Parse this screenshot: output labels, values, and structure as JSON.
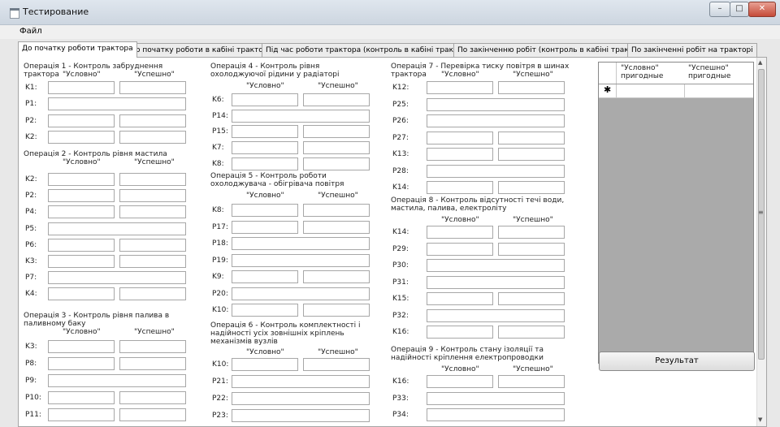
{
  "window": {
    "title": "Тестирование",
    "buttons": {
      "minimize": "–",
      "maximize": "□",
      "close": "✕"
    }
  },
  "menu": {
    "file": "Файл"
  },
  "tabs": [
    "До початку роботи трактора",
    "До початку роботи в кабіні трактора",
    "Під час роботи трактора (контроль в кабіні трактора)",
    "По закінченню робіт (контроль в кабіні трактора)",
    "По закінченні робіт на тракторі"
  ],
  "columns": {
    "c1": "\"Условно\"",
    "c2": "\"Успешно\""
  },
  "operations": [
    {
      "title": "Операція 1 - Контроль забруднення трактора",
      "rows": [
        {
          "label": "K1:",
          "split": true
        },
        {
          "label": "P1:",
          "split": false
        },
        {
          "label": "P2:",
          "split": true
        },
        {
          "label": "K2:",
          "split": true
        }
      ]
    },
    {
      "title": "Операція 2 - Контроль рівня мастила",
      "rows": [
        {
          "label": "K2:",
          "split": true
        },
        {
          "label": "P2:",
          "split": true
        },
        {
          "label": "P4:",
          "split": true
        },
        {
          "label": "P5:",
          "split": false
        },
        {
          "label": "P6:",
          "split": true
        },
        {
          "label": "K3:",
          "split": true
        },
        {
          "label": "P7:",
          "split": false
        },
        {
          "label": "K4:",
          "split": true
        }
      ]
    },
    {
      "title": "Операція 3 - Контроль рівня палива в паливному баку",
      "rows": [
        {
          "label": "K3:",
          "split": true
        },
        {
          "label": "P8:",
          "split": true
        },
        {
          "label": "P9:",
          "split": false
        },
        {
          "label": "P10:",
          "split": true
        },
        {
          "label": "P11:",
          "split": true
        }
      ]
    },
    {
      "title": "Операція 4 -   Контроль рівня охолоджуючої рідини у радіаторі",
      "rows": [
        {
          "label": "K6:",
          "split": true
        },
        {
          "label": "P14:",
          "split": false
        },
        {
          "label": "P15:",
          "split": true
        },
        {
          "label": "K7:",
          "split": true
        },
        {
          "label": "K8:",
          "split": true
        }
      ]
    },
    {
      "title": "Операція 5 - Контроль роботи охолоджувача - обігрівача повітря",
      "rows": [
        {
          "label": "K8:",
          "split": true
        },
        {
          "label": "P17:",
          "split": true
        },
        {
          "label": "P18:",
          "split": false
        },
        {
          "label": "P19:",
          "split": false
        },
        {
          "label": "K9:",
          "split": true
        },
        {
          "label": "P20:",
          "split": false
        },
        {
          "label": "K10:",
          "split": true
        }
      ]
    },
    {
      "title": "Операція 6 - Контроль комплектності і надійності усіх зовнішніх кріплень механізмів вузлів",
      "rows": [
        {
          "label": "K10:",
          "split": true
        },
        {
          "label": "P21:",
          "split": false
        },
        {
          "label": "P22:",
          "split": false
        },
        {
          "label": "P23:",
          "split": false
        }
      ]
    },
    {
      "title": "Операція 7 - Перевірка тиску повітря в шинах трактора",
      "rows": [
        {
          "label": "K12:",
          "split": true
        },
        {
          "label": "P25:",
          "split": false
        },
        {
          "label": "P26:",
          "split": false
        },
        {
          "label": "P27:",
          "split": true
        },
        {
          "label": "K13:",
          "split": true
        },
        {
          "label": "P28:",
          "split": false
        },
        {
          "label": "K14:",
          "split": true
        }
      ]
    },
    {
      "title": "Операція 8 - Контроль відсутності течі води, мастила, палива, електроліту",
      "rows": [
        {
          "label": "K14:",
          "split": true
        },
        {
          "label": "P29:",
          "split": true
        },
        {
          "label": "P30:",
          "split": false
        },
        {
          "label": "P31:",
          "split": false
        },
        {
          "label": "K15:",
          "split": true
        },
        {
          "label": "P32:",
          "split": false
        },
        {
          "label": "K16:",
          "split": true
        }
      ]
    },
    {
      "title": "Операція 9 - Контроль стану ізоляції та надійності кріплення електропроводки",
      "rows": [
        {
          "label": "K16:",
          "split": true
        },
        {
          "label": "P33:",
          "split": false
        },
        {
          "label": "P34:",
          "split": false
        }
      ]
    }
  ],
  "grid": {
    "col1": "\"Условно\" пригодные",
    "col2": "\"Успешно\" пригодные",
    "new_row_marker": "✱"
  },
  "result_button": "Результат"
}
